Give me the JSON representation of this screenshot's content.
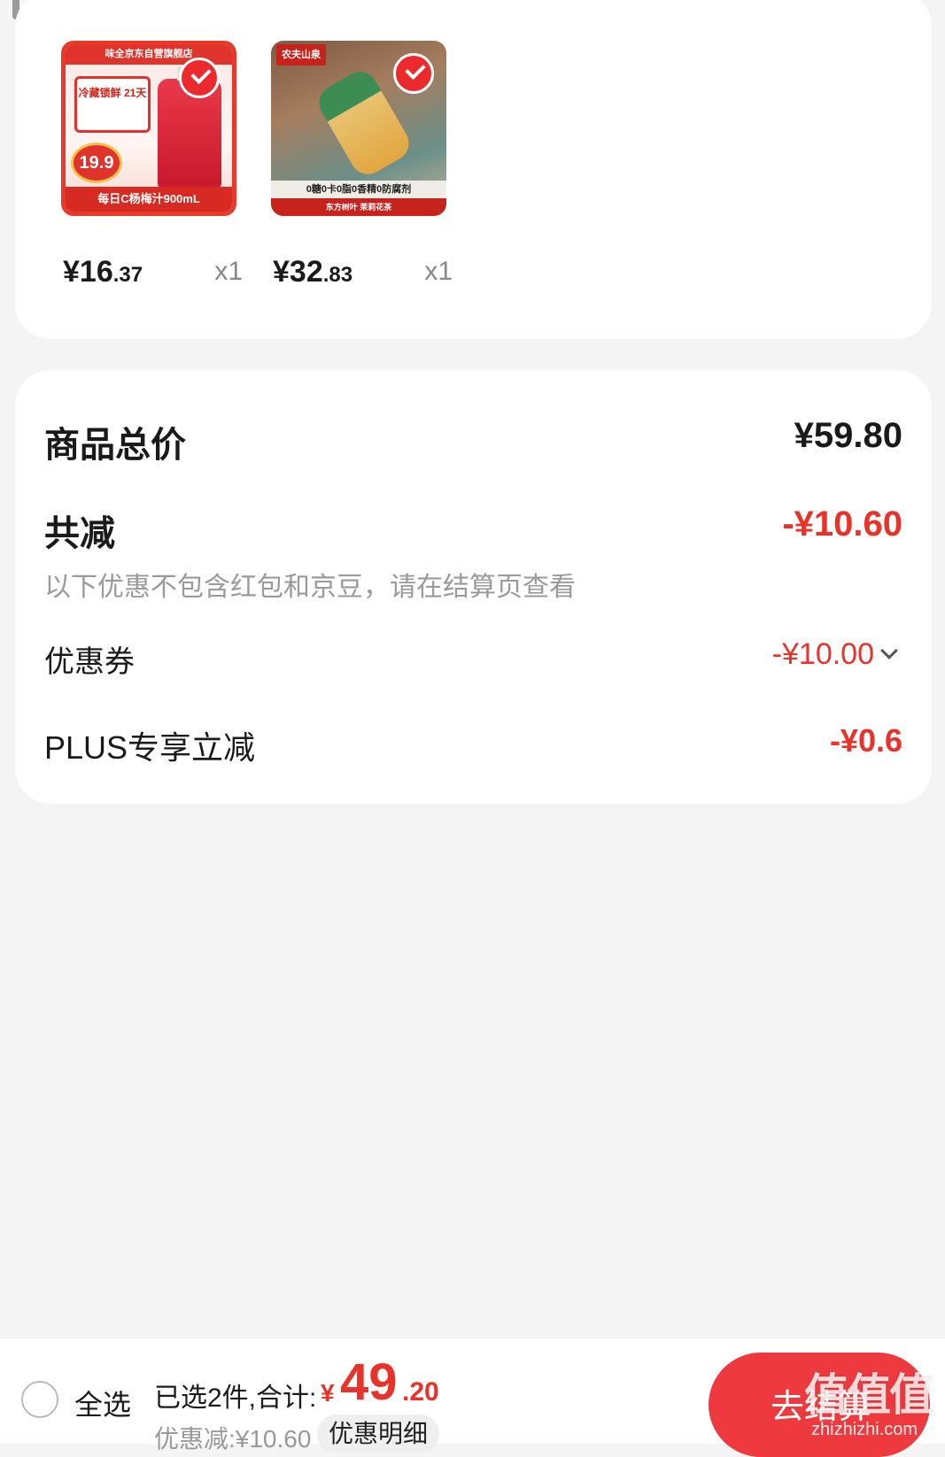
{
  "products": [
    {
      "thumb": {
        "store_banner": "味全京东自营旗舰店",
        "tag": "冷藏锁鲜 21天",
        "badge_price": "19.9",
        "bottom_banner": "每日C杨梅汁900mL"
      },
      "price_main": "¥16",
      "price_decimal": ".37",
      "quantity": "x1",
      "checked": true
    },
    {
      "thumb": {
        "brand": "农夫山泉",
        "mid_banner": "0糖0卡0脂0香精0防腐剂",
        "bottom_banner": "东方树叶 茉莉花茶"
      },
      "price_main": "¥32",
      "price_decimal": ".83",
      "quantity": "x1",
      "checked": true
    }
  ],
  "summary": {
    "total_label": "商品总价",
    "total_value": "¥59.80",
    "reduce_label": "共减",
    "reduce_value": "-¥10.60",
    "note": "以下优惠不包含红包和京豆，请在结算页查看",
    "coupon_label": "优惠券",
    "coupon_value": "-¥10.00",
    "plus_label": "PLUS专享立减",
    "plus_value": "-¥0.6"
  },
  "bottom_bar": {
    "select_all": "全选",
    "selected_text": "已选2件,合计:",
    "total_currency": "¥",
    "total_integer": "49",
    "total_decimal": ".20",
    "discount_text": "优惠减:¥10.60",
    "detail_button": "优惠明细",
    "checkout_button": "去结算",
    "watermark": "值值值",
    "watermark_sub": "zhizhizhi.com"
  },
  "colors": {
    "accent_red": "#e8322a",
    "button_red": "#ee3a3e",
    "background": "#f4f4f4"
  }
}
